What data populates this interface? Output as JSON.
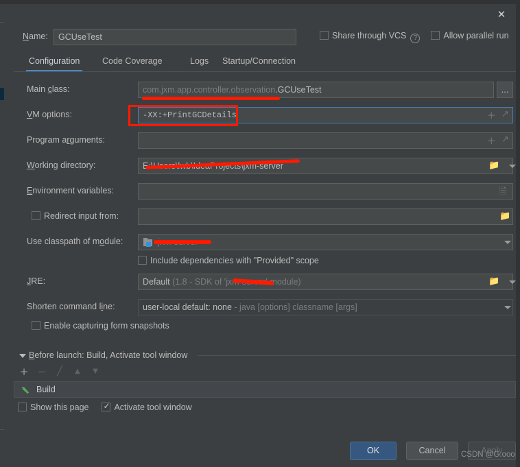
{
  "window": {
    "close_icon": "close-icon"
  },
  "name_row": {
    "label": "Name:",
    "label_mnemonic": "N",
    "value": "GCUseTest",
    "share_vcs_label": "Share through VCS",
    "share_vcs_checked": false,
    "help_icon": "?",
    "allow_parallel_label": "Allow parallel run",
    "allow_parallel_checked": false
  },
  "tabs": [
    {
      "label": "Configuration",
      "active": true
    },
    {
      "label": "Code Coverage",
      "active": false
    },
    {
      "label": "Logs",
      "active": false
    },
    {
      "label": "Startup/Connection",
      "active": false
    }
  ],
  "fields": {
    "main_class": {
      "label": "Main class:",
      "value_redacted": "com.jxm.app.controller.observation",
      "value_visible": ".GCUseTest",
      "browse_button": "..."
    },
    "vm_options": {
      "label": "VM options:",
      "value": "-XX:+PrintGCDetails",
      "focused": true,
      "add_icon": "+",
      "expand_icon": "expand-icon"
    },
    "program_arguments": {
      "label": "Program arguments:",
      "value": "",
      "add_icon": "+",
      "expand_icon": "expand-icon"
    },
    "working_directory": {
      "label": "Working directory:",
      "value": "E:\\Users\\lwb\\IdeaProjects\\jxm-server",
      "browse_icon": "folder-icon",
      "dropdown_icon": "chevron-down-icon"
    },
    "environment_variables": {
      "label": "Environment variables:",
      "value": "",
      "editor_icon": "list-editor-icon"
    },
    "redirect_input": {
      "label": "Redirect input from:",
      "checked": false,
      "value": "",
      "browse_icon": "folder-icon"
    },
    "use_classpath_of_module": {
      "label": "Use classpath of module:",
      "value_redacted": "jxm-server",
      "module_icon": "module-icon",
      "dropdown_icon": "chevron-down-icon"
    },
    "include_provided": {
      "label": "Include dependencies with \"Provided\" scope",
      "checked": false
    },
    "jre": {
      "label": "JRE:",
      "value_prefix": "Default",
      "value_suffix_a": " (1.8 - SDK of '",
      "value_redacted": "jxm-server",
      "value_suffix_b": "' module)",
      "browse_icon": "folder-icon",
      "dropdown_icon": "chevron-down-icon"
    },
    "shorten_command_line": {
      "label": "Shorten command line:",
      "value": "user-local default: none",
      "value_hint": " - java [options] classname [args]",
      "dropdown_icon": "chevron-down-icon"
    },
    "enable_form_snapshots": {
      "label": "Enable capturing form snapshots",
      "checked": false
    }
  },
  "before_launch": {
    "title": "Before launch: Build, Activate tool window",
    "collapse_icon": "triangle-down-icon",
    "toolbar": [
      {
        "name": "add-button",
        "glyph": "+",
        "enabled": true
      },
      {
        "name": "remove-button",
        "glyph": "−",
        "enabled": false
      },
      {
        "name": "edit-button",
        "glyph": "╱",
        "enabled": false
      },
      {
        "name": "move-up-button",
        "glyph": "▲",
        "enabled": false
      },
      {
        "name": "move-down-button",
        "glyph": "▼",
        "enabled": false
      }
    ],
    "items": [
      {
        "label": "Build",
        "icon": "build-hammer-icon"
      }
    ],
    "show_this_page": {
      "label": "Show this page",
      "checked": false
    },
    "activate_tool_window": {
      "label": "Activate tool window",
      "checked": true
    }
  },
  "footer": {
    "ok": "OK",
    "cancel": "Cancel",
    "apply": "Apply",
    "apply_disabled": true
  },
  "watermark": "CSDN @G.ooo",
  "colors": {
    "dialog_bg": "#3c3f41",
    "field_bg": "#45494a",
    "field_border": "#5e6060",
    "focus_border": "#4b7eb8",
    "accent_tab": "#4a88c7",
    "primary_button": "#365880",
    "redaction": "#ff1a00",
    "build_icon_green": "#5aa75a",
    "module_icon_blue": "#3592d6",
    "text": "#bbbbbb"
  }
}
